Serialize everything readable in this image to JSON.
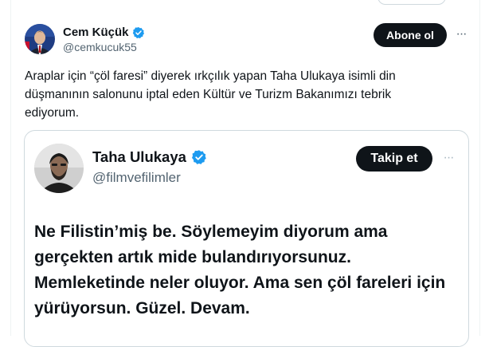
{
  "post": {
    "author_name": "Cem Küçük",
    "author_handle": "@cemkucuk55",
    "follow_label": "Abone ol",
    "more_label": "···",
    "text": "Araplar için “çöl faresi” diyerek ırkçılık yapan Taha Ulukaya isimli din düşmanının salonunu iptal eden Kültür ve Turizm Bakanımızı tebrik ediyorum."
  },
  "quote": {
    "author_name": "Taha Ulukaya",
    "author_handle": "@filmvefilimler",
    "follow_label": "Takip et",
    "more_label": "···",
    "text": "Ne Filistin’miş be. Söylemeyim diyorum ama gerçekten artık mide bulandırıyorsunuz. Memleketinde neler oluyor. Ama sen çöl fareleri için yürüyorsun. Güzel. Devam."
  },
  "icons": {
    "verified_badge": "verified-badge-icon",
    "more": "more-icon",
    "avatar": "avatar"
  },
  "colors": {
    "verified": "#1d9bf0",
    "button_bg": "#0f1419",
    "secondary_text": "#536471",
    "border": "#cfd9de"
  }
}
